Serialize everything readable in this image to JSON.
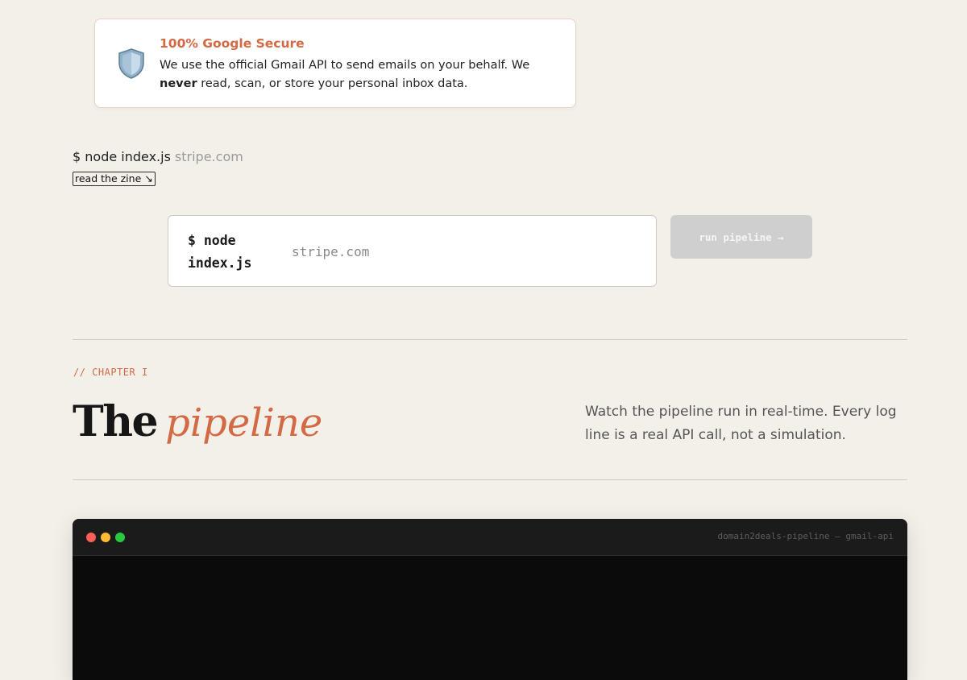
{
  "notice": {
    "icon": "shield-icon",
    "title": "100% Google Secure",
    "body_before": "We use the official Gmail API to send emails on your behalf. We ",
    "body_strong": "never",
    "body_after": " read, scan, or store your personal inbox data.",
    "accent_color": "#d46a45"
  },
  "command": {
    "prefix": "$ node index.js",
    "domain": "stripe.com"
  },
  "zine_button": {
    "label": "read the zine ↘"
  },
  "pipeline_form": {
    "prefix": "$ node index.js",
    "input_value": "",
    "input_placeholder": "stripe.com",
    "run_button_label": "run pipeline →"
  },
  "chapter": {
    "label": "// CHAPTER I",
    "heading_plain": "The",
    "heading_accent": "pipeline",
    "description": "Watch the pipeline run in real-time. Every log line is a real API call, not a simulation."
  },
  "terminal": {
    "title": "domain2deals-pipeline — gmail-api",
    "window_buttons": [
      "close",
      "minimize",
      "maximize"
    ],
    "colors": {
      "close": "#ff5f57",
      "minimize": "#febc2e",
      "maximize": "#28c840"
    }
  },
  "theme": {
    "background": "#f3f0ea",
    "accent": "#d46a45",
    "text": "#222222"
  }
}
